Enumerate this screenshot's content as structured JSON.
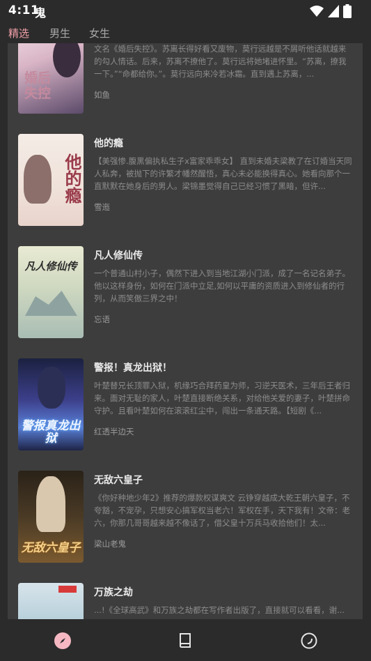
{
  "status": {
    "time": "4:11",
    "glyph": "鬼"
  },
  "tabs": [
    {
      "label": "精选"
    },
    {
      "label": "男生"
    },
    {
      "label": "女生"
    }
  ],
  "books": [
    {
      "title": "",
      "cover_text": "婚后失控",
      "desc": "文名《婚后失控》。苏离长得好看又废物，莫行远越是不屑听他话就越来的勾人情话。后来，苏离不撩他了。莫行远将她堵进怀里。“苏离，撩我一下。”“命都给你。”。莫行远向来冷若冰霜。直到遇上苏离，...",
      "author": "如鱼"
    },
    {
      "title": "他的瘾",
      "cover_text": "他的瘾",
      "desc": "【美强惨.腹黑偏执私生子x富家乖乖女】 直到未婚夫梁教了在订婚当天同人私奔，被抛下的许繁才幡然醒悟，真心未必能换得真心。她看向那个一直默默在她身后的男人。梁锦墨觉得自己已经习惯了黑暗，但许...",
      "author": "雪迤"
    },
    {
      "title": "凡人修仙传",
      "cover_text": "凡人修仙传",
      "desc": "一个普通山村小子，偶然下进入到当地江湖小门派，成了一名记名弟子。他以这样身份，如何在门派中立足,如何以平庸的资质进入到修仙者的行列，从而笑傲三界之中！",
      "author": "忘语"
    },
    {
      "title": "警报！真龙出狱！",
      "cover_text": "警报真龙出狱",
      "desc": "叶楚替兄长顶罪入狱，机缘巧合拜药皇为师，习逆天医术，三年后王者归来。面对无耻的家人，叶楚直接断绝关系，对给他关爱的妻子，叶楚拼命守护。且看叶楚如何在滚滚红尘中，闯出一条通天路。【短剧《...",
      "author": "红透半边天"
    },
    {
      "title": "无敌六皇子",
      "cover_text": "无敌六皇子",
      "desc": "《你好种地少年2》推荐的爆款权谋爽文 云铮穿越成大乾王朝六皇子，不夸豁，不宠孕，只想安心搞军权当老六！军权在手，天下我有！文帝：老六，你那几哥哥越来越不像话了，借父皇十万兵马收拾他们！太...",
      "author": "梁山老鬼"
    },
    {
      "title": "万族之劫",
      "cover_text": "",
      "desc": "...!《全球高武》和万族之劫都在写作者出版了，直接就可以看看，谢...",
      "author": ""
    }
  ],
  "nav": [
    {
      "icon": "compass-icon"
    },
    {
      "icon": "bookshelf-icon"
    },
    {
      "icon": "profile-circle-icon"
    }
  ]
}
